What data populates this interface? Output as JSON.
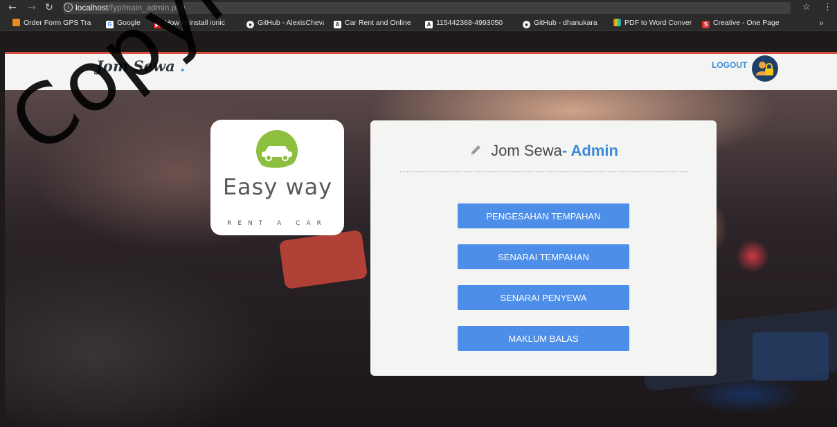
{
  "browser": {
    "url_host": "localhost",
    "url_path": "/fyp/main_admin.php",
    "bookmarks": [
      {
        "label": "Order Form GPS Tra",
        "icon": "orange-app-icon"
      },
      {
        "label": "Google",
        "icon": "google-icon"
      },
      {
        "label": "How to install ionic",
        "icon": "youtube-icon"
      },
      {
        "label": "GitHub - AlexisCheva",
        "icon": "github-icon"
      },
      {
        "label": "Car Rent and Online",
        "icon": "document-a-icon"
      },
      {
        "label": "115442368-4993050",
        "icon": "document-a-icon"
      },
      {
        "label": "GitHub - dhanukara",
        "icon": "github-icon"
      },
      {
        "label": "PDF to Word Conver",
        "icon": "pdf-converter-icon"
      },
      {
        "label": "Creative - One Page",
        "icon": "s-icon"
      }
    ],
    "more_label": "»"
  },
  "header": {
    "brand": "Jom Sewa",
    "brand_dot": ".",
    "logout_label": "LOGOUT",
    "accent_color": "#d94e43"
  },
  "logo": {
    "word": "Easy way",
    "tagline": "RENT A CAR",
    "color": "#8dbf3e"
  },
  "panel": {
    "title": "Jom Sewa",
    "title_suffix": "- Admin",
    "buttons": [
      "PENGESAHAN TEMPAHAN",
      "SENARAI TEMPAHAN",
      "SENARAI PENYEWA",
      "MAKLUM BALAS"
    ],
    "button_color": "#4d8ee8"
  },
  "watermark": "Copyright"
}
